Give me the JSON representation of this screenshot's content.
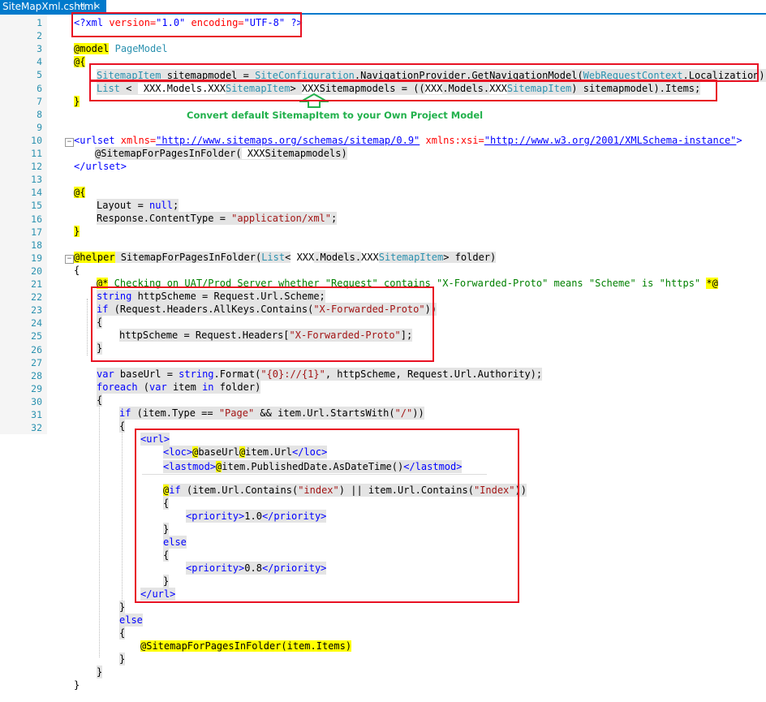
{
  "tab": {
    "title": "SiteMapXml.cshtml",
    "pin_glyph": "⊣",
    "close_glyph": "×"
  },
  "line_numbers": [
    "1",
    "2",
    "3",
    "4",
    "5",
    "6",
    "7",
    "8",
    "9",
    "10",
    "11",
    "12",
    "13",
    "14",
    "15",
    "16",
    "17",
    "18",
    "19",
    "20",
    "21",
    "22",
    "23",
    "24",
    "25",
    "26",
    "27",
    "28",
    "29",
    "30",
    "31",
    "32"
  ],
  "code": {
    "l1": {
      "a": "<?xml ",
      "b": "version=",
      "c": "\"1.0\"",
      "d": " encoding=",
      "e": "\"UTF-8\"",
      "f": " ?>"
    },
    "l3": {
      "a": "@model",
      "b": " ",
      "c": "PageModel"
    },
    "l4": {
      "a": "@{"
    },
    "l5": {
      "a": "SitemapItem",
      "b": " sitemapmodel = ",
      "c": "SiteConfiguration",
      "d": ".NavigationProvider.GetNavigationModel(",
      "e": "WebRequestContext",
      "f": ".Localization);"
    },
    "l6": {
      "a": "List",
      "b": " < ",
      "c": " XXX.Models.XXX",
      "d": "SitemapItem",
      "e": "> ",
      "f": "XXX",
      "g": "Sitemapmodels = ((",
      "h": "XXX",
      "i": ".Models.",
      "j": "XXX",
      "k": "SitemapItem",
      "l": ") sitemapmodel).Items;"
    },
    "l7": {
      "a": "}"
    },
    "annotation": "Convert default SitemapItem to your Own Project Model",
    "l10": {
      "a": "<urlset ",
      "b": "xmlns=",
      "c": "\"http://www.sitemaps.org/schemas/sitemap/0.9\"",
      "d": " xmlns:xsi=",
      "e": "\"http://www.w3.org/2001/XMLSchema-instance\"",
      "f": ">"
    },
    "l11": {
      "a": "@SitemapForPagesInFolder(",
      "b": " XXX",
      "c": "Sitemapmodels)"
    },
    "l12": {
      "a": "</urlset>"
    },
    "l14": {
      "a": "@{"
    },
    "l15": {
      "a": "Layout = ",
      "b": "null",
      "c": ";"
    },
    "l16": {
      "a": "Response.ContentType = ",
      "b": "\"application/xml\"",
      "c": ";"
    },
    "l17": {
      "a": "}"
    },
    "l19": {
      "a": "@helper",
      "b": " SitemapForPagesInFolder(",
      "c": "List",
      "d": "<",
      "e": " XXX",
      "f": ".Models.",
      "g": "XXX",
      "h": "SitemapItem",
      "i": "> folder)"
    },
    "l20": {
      "a": "{"
    },
    "l21": {
      "a": "@*",
      "b": " Checking on UAT/Prod Server whether \"Request\" contains \"X-Forwarded-Proto\" means \"Scheme\" is \"https\" ",
      "c": "*@"
    },
    "l22": {
      "a": "string",
      "b": " httpScheme = Request.Url.Scheme;"
    },
    "l23": {
      "a": "if",
      "b": " (Request.Headers.AllKeys.Contains(",
      "c": "\"X-Forwarded-Proto\"",
      "d": "))"
    },
    "l24": {
      "a": "{"
    },
    "l25": {
      "a": "httpScheme = Request.Headers[",
      "b": "\"X-Forwarded-Proto\"",
      "c": "];"
    },
    "l26": {
      "a": "}"
    },
    "l28": {
      "a": "var",
      "b": " baseUrl = ",
      "c": "string",
      "d": ".Format(",
      "e": "\"{0}://{1}\"",
      "f": ", httpScheme, Request.Url.Authority);"
    },
    "l29": {
      "a": "foreach",
      "b": " (",
      "c": "var",
      "d": " item ",
      "e": "in",
      "f": " folder)"
    },
    "l30": {
      "a": "{"
    },
    "l31": {
      "a": "if",
      "b": " (item.Type == ",
      "c": "\"Page\"",
      "d": " && item.Url.StartsWith(",
      "e": "\"/\"",
      "f": "))"
    },
    "l32": {
      "a": "{"
    },
    "x1": {
      "a": "<url>"
    },
    "x2": {
      "a": "<loc>",
      "b": "@",
      "c": "baseUrl",
      "d": "@",
      "e": "item.Url",
      "f": "</loc>"
    },
    "x3": {
      "a": "<lastmod>",
      "b": "@",
      "c": "item.PublishedDate.AsDateTime()",
      "d": "</lastmod>"
    },
    "x4": {
      "a": "@",
      "b": "if",
      "c": " (item.Url.Contains(",
      "d": "\"index\"",
      "e": ") || item.Url.Contains(",
      "f": "\"Index\"",
      "g": "))"
    },
    "x5": {
      "a": "{"
    },
    "x6": {
      "a": "<priority>",
      "b": "1.0",
      "c": "</priority>"
    },
    "x7": {
      "a": "}"
    },
    "x8": {
      "a": "else"
    },
    "x9": {
      "a": "{"
    },
    "x10": {
      "a": "<priority>",
      "b": "0.8",
      "c": "</priority>"
    },
    "x11": {
      "a": "}"
    },
    "x12": {
      "a": "</url>"
    },
    "x13": {
      "a": "}"
    },
    "x14": {
      "a": "else"
    },
    "x15": {
      "a": "{"
    },
    "x16": {
      "a": "@SitemapForPagesInFolder(item.Items)"
    },
    "x17": {
      "a": "}"
    },
    "x18": {
      "a": "}"
    },
    "x19": {
      "a": "}"
    }
  },
  "colors": {
    "keyword": "#0000ff",
    "type": "#2b91af",
    "string": "#a31515",
    "razor_highlight": "#ffff00",
    "annotation": "#22b14c",
    "callout_box": "#e81123",
    "tab_accent": "#007acc"
  }
}
